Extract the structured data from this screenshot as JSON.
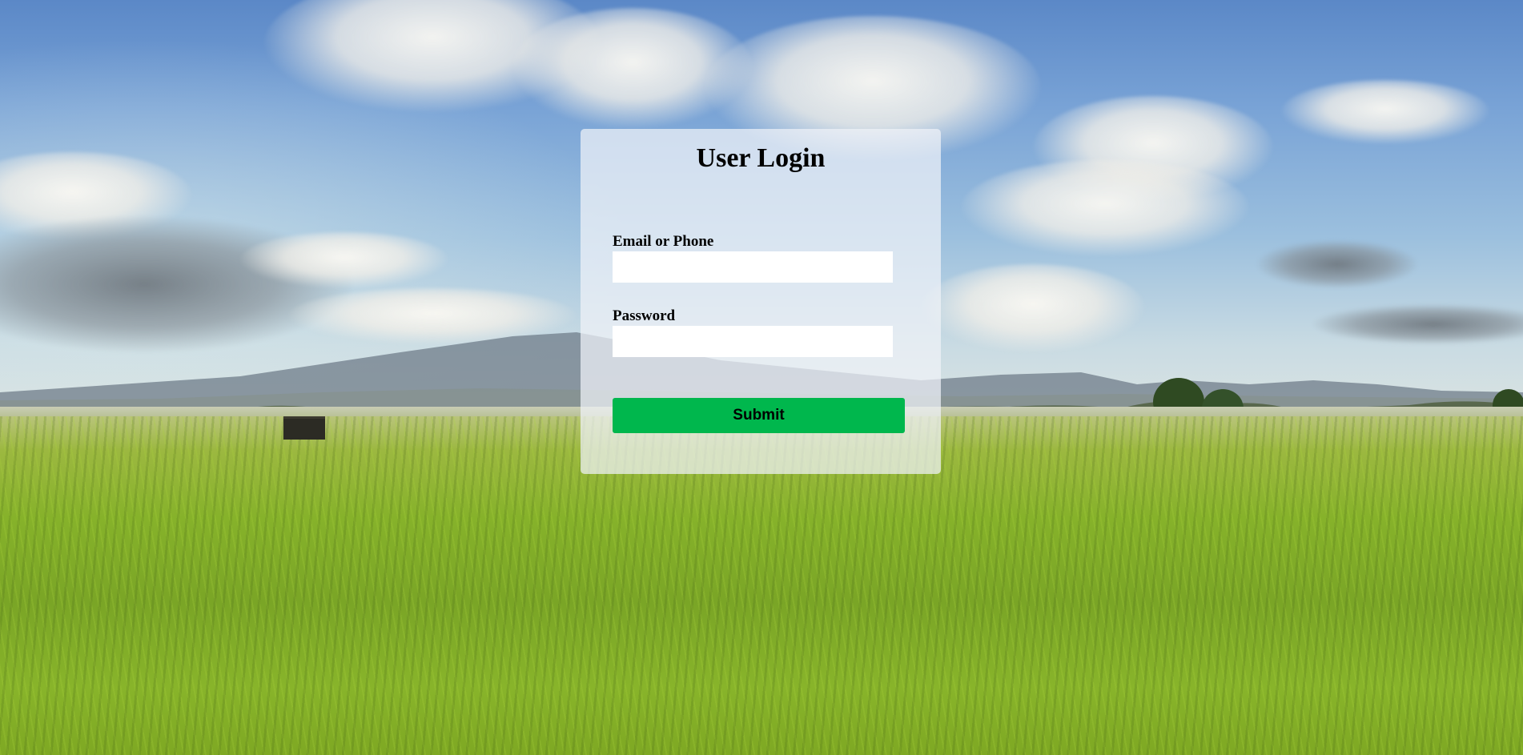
{
  "login": {
    "title": "User Login",
    "email_label": "Email or Phone",
    "email_value": "",
    "password_label": "Password",
    "password_value": "",
    "submit_label": "Submit"
  },
  "colors": {
    "submit_button": "#00b74d",
    "panel_background": "rgba(240,243,248,0.72)"
  },
  "background": {
    "description_icon": "landscape-background"
  }
}
